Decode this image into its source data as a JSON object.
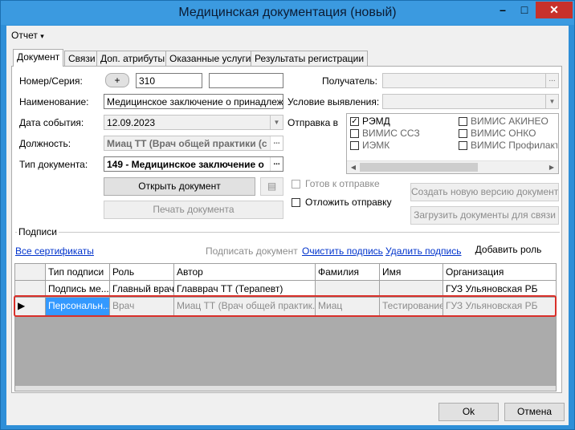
{
  "window": {
    "title": "Медицинская документация (новый)"
  },
  "menu": {
    "report": "Отчет",
    "report_arrow": "▾"
  },
  "tabs": [
    {
      "label": "Документ"
    },
    {
      "label": "Связи"
    },
    {
      "label": "Доп. атрибуты"
    },
    {
      "label": "Оказанные услуги"
    },
    {
      "label": "Результаты регистрации"
    }
  ],
  "form": {
    "number_label": "Номер/Серия:",
    "plus": "+",
    "number_value": "310",
    "series_value": "",
    "name_label": "Наименование:",
    "name_value": "Медицинское заключение о принадлежнос",
    "event_date_label": "Дата события:",
    "event_date_value": "12.09.2023",
    "position_label": "Должность:",
    "position_value": "Миац ТТ (Врач общей практики (с",
    "doc_type_label": "Тип документа:",
    "doc_type_value": "149 - Медицинское заключение о",
    "recipient_label": "Получатель:",
    "condition_label": "Условие выявления:",
    "send_label": "Отправка в",
    "open_doc": "Открыть документ",
    "print_doc": "Печать документа",
    "ready_label": "Готов к отправке",
    "postpone_label": "Отложить отправку",
    "new_version": "Создать новую версию документ",
    "load_docs": "Загрузить документы для связи",
    "ellipsis": "...",
    "ellipsis_short": "..."
  },
  "send_targets": [
    {
      "label": "РЭМД",
      "checked": true
    },
    {
      "label": "ВИМИС АКИНЕО",
      "checked": false
    },
    {
      "label": "ВИМИС ССЗ",
      "checked": false
    },
    {
      "label": "ВИМИС ОНКО",
      "checked": false
    },
    {
      "label": "ИЭМК",
      "checked": false
    },
    {
      "label": "ВИМИС Профилактика",
      "checked": false
    }
  ],
  "signatures": {
    "group_label": "Подписи",
    "all_certs": "Все сертификаты",
    "sign_doc": "Подписать документ",
    "clear_sign": "Очистить подпись",
    "delete_sign": "Удалить подпись",
    "add_role": "Добавить роль",
    "columns": [
      "Тип подписи",
      "Роль",
      "Автор",
      "Фамилия",
      "Имя",
      "Организация"
    ],
    "rows": [
      [
        "Подпись ме...",
        "Главный врач",
        "Главврач ТТ (Терапевт)",
        "",
        "",
        "ГУЗ Ульяновская РБ"
      ],
      [
        "Персональн...",
        "Врач",
        "Миац ТТ (Врач общей практик...",
        "Миац",
        "Тестирование",
        "ГУЗ Ульяновская РБ"
      ]
    ],
    "current_marker": "▶"
  },
  "footer": {
    "ok": "Ok",
    "cancel": "Отмена"
  },
  "colors": {
    "title_bar": "#3b9ae0",
    "selection": "#3399ff",
    "highlight": "#d9302a"
  }
}
